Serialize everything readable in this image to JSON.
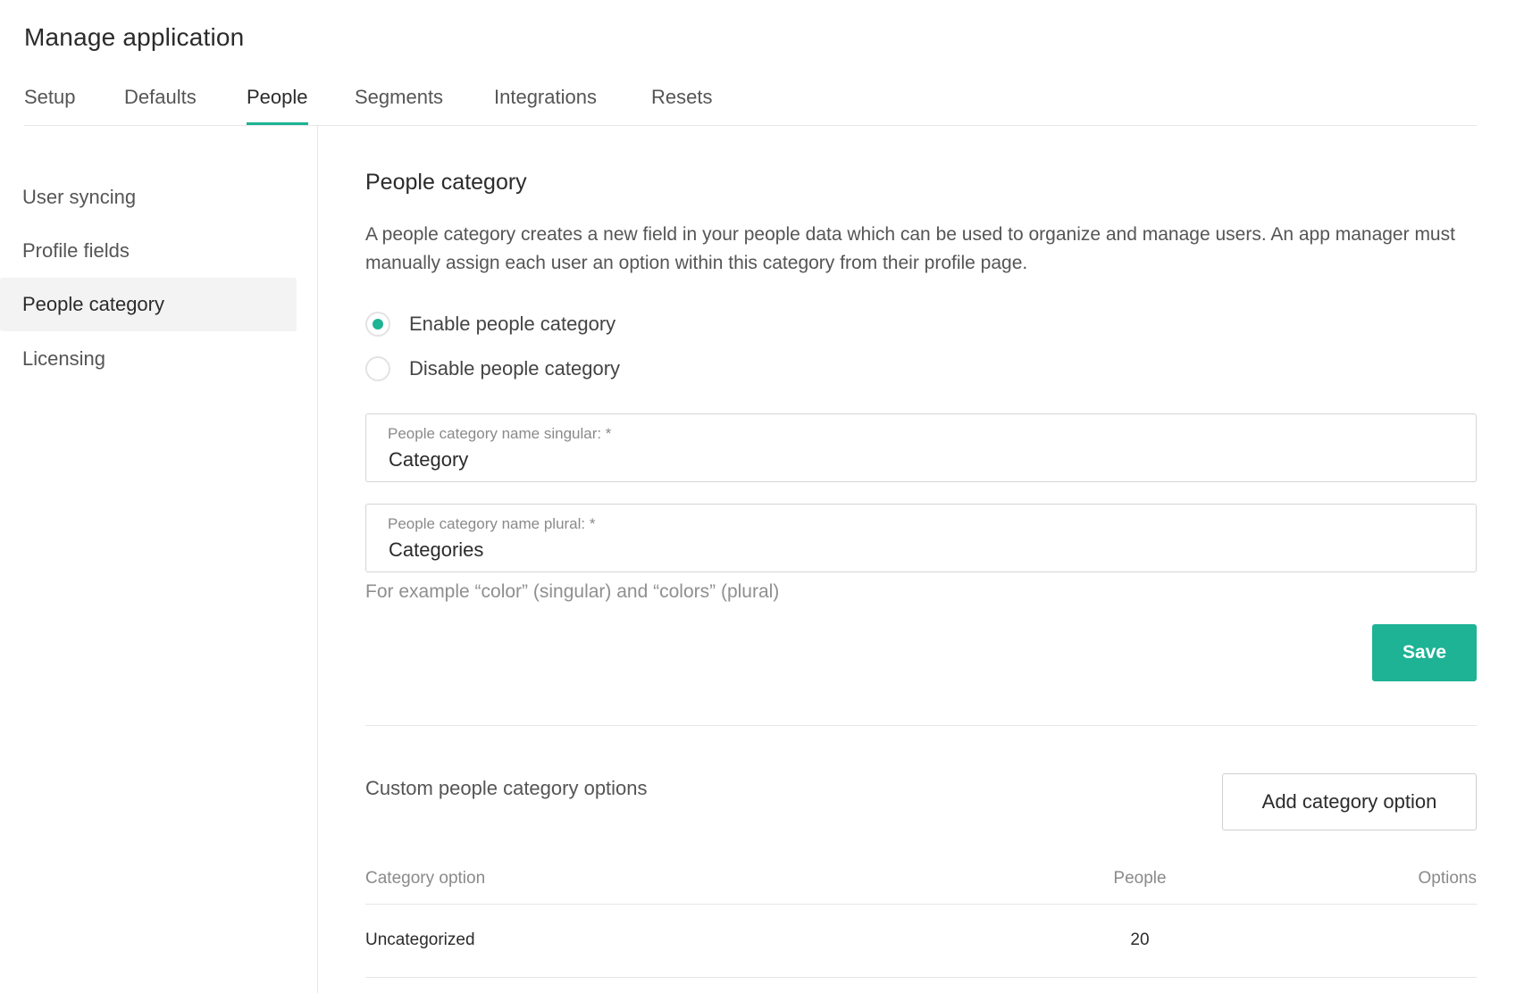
{
  "header": {
    "title": "Manage application"
  },
  "tabs": [
    {
      "label": "Setup"
    },
    {
      "label": "Defaults"
    },
    {
      "label": "People",
      "active": true
    },
    {
      "label": "Segments"
    },
    {
      "label": "Integrations"
    },
    {
      "label": "Resets"
    }
  ],
  "sidebar": {
    "items": [
      {
        "label": "User syncing"
      },
      {
        "label": "Profile fields"
      },
      {
        "label": "People category",
        "active": true
      },
      {
        "label": "Licensing"
      }
    ]
  },
  "main": {
    "title": "People category",
    "description": "A people category creates a new field in your people data which can be used to organize and manage users. An app manager must manually assign each user an option within this category from their profile page.",
    "radios": [
      {
        "label": "Enable people category",
        "checked": true
      },
      {
        "label": "Disable people category",
        "checked": false
      }
    ],
    "fields": {
      "singular": {
        "label": "People category name singular: *",
        "value": "Category"
      },
      "plural": {
        "label": "People category name plural: *",
        "value": "Categories"
      }
    },
    "hint": "For example “color” (singular) and “colors” (plural)",
    "save_label": "Save"
  },
  "options_section": {
    "title": "Custom people category options",
    "add_button_label": "Add category option",
    "table": {
      "columns": [
        "Category option",
        "People",
        "Options"
      ],
      "rows": [
        {
          "option": "Uncategorized",
          "people": "20",
          "options": ""
        }
      ]
    }
  },
  "colors": {
    "accent": "#1db394"
  }
}
